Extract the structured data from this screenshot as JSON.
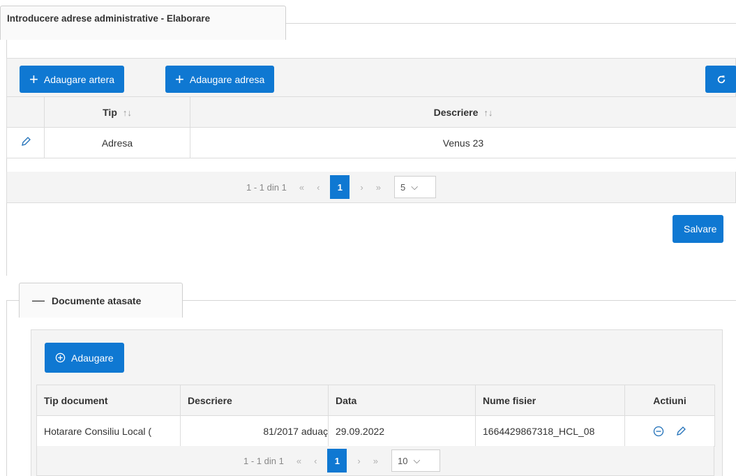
{
  "panel": {
    "title": "Introducere adrese administrative - Elaborare"
  },
  "toolbar": {
    "add_artera_label": "Adaugare artera",
    "add_adresa_label": "Adaugare adresa",
    "refresh_icon": "refresh-icon"
  },
  "address_table": {
    "columns": [
      "Tip",
      "Descriere"
    ],
    "rows": [
      {
        "tip": "Adresa",
        "descriere": "Venus 23"
      }
    ],
    "pager": {
      "summary": "1 - 1 din 1",
      "first": "«",
      "prev": "‹",
      "current_page": "1",
      "next": "›",
      "last": "»",
      "page_size": "5"
    }
  },
  "save_label": "Salvare",
  "documents": {
    "section_title": "Documente atasate",
    "add_label": "Adaugare",
    "columns": [
      "Tip document",
      "Descriere",
      "Data",
      "Nume fisier",
      "Actiuni"
    ],
    "rows": [
      {
        "tip_document": "Hotarare Consiliu Local (",
        "descriere": "81/2017 aduaç",
        "data": "29.09.2022",
        "nume_fisier": "1664429867318_HCL_08"
      }
    ],
    "pager": {
      "summary": "1 - 1 din 1",
      "first": "«",
      "prev": "‹",
      "current_page": "1",
      "next": "›",
      "last": "»",
      "page_size": "10"
    }
  },
  "colors": {
    "accent": "#0f78d2",
    "header_bg": "#f4f4f4",
    "border": "#dcdcdc"
  }
}
